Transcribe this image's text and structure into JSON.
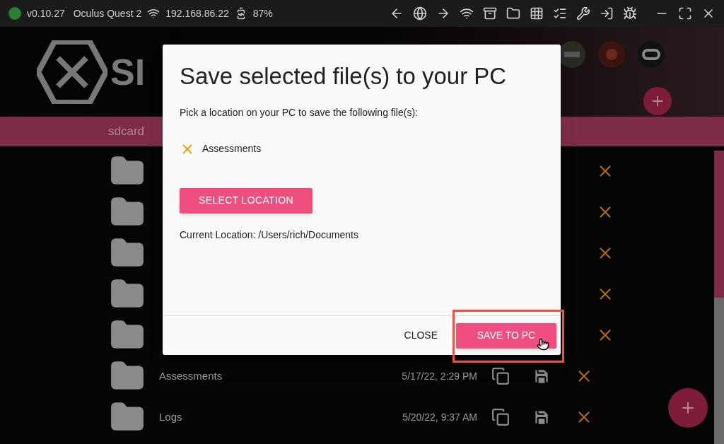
{
  "status_bar": {
    "connected": true,
    "version": "v0.10.27",
    "device": "Oculus Quest 2",
    "ip": "192.168.86.22",
    "battery": "87%"
  },
  "header": {
    "logo_text": "SI"
  },
  "breadcrumb": {
    "path": "sdcard"
  },
  "files": [
    {
      "covered": true
    },
    {
      "covered": true
    },
    {
      "covered": true
    },
    {
      "covered": true
    },
    {
      "covered": true
    },
    {
      "covered": false,
      "name": "Assessments",
      "date": "5/17/22, 2:29 PM"
    },
    {
      "covered": false,
      "name": "Logs",
      "date": "5/20/22, 9:37 AM"
    }
  ],
  "dialog": {
    "title": "Save selected file(s) to your PC",
    "prompt": "Pick a location on your PC to save the following file(s):",
    "files": [
      {
        "name": "Assessments"
      }
    ],
    "select_button": "SELECT LOCATION",
    "current_location": "Current Location: /Users/rich/Documents",
    "close_button": "CLOSE",
    "save_button": "SAVE TO PC",
    "save_highlighted": true
  }
}
